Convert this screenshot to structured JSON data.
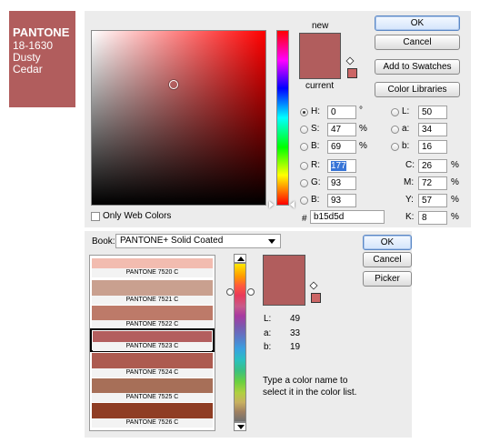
{
  "card": {
    "brand": "PANTONE",
    "code": "18-1630",
    "name_line1": "Dusty",
    "name_line2": "Cedar",
    "color": "#b15d5d"
  },
  "picker": {
    "new_label": "new",
    "current_label": "current",
    "ok": "OK",
    "cancel": "Cancel",
    "add_to_swatches": "Add to Swatches",
    "color_libraries": "Color Libraries",
    "only_web_colors": "Only Web Colors",
    "hsb": [
      {
        "label": "H:",
        "value": "0",
        "unit": "°"
      },
      {
        "label": "S:",
        "value": "47",
        "unit": "%"
      },
      {
        "label": "B:",
        "value": "69",
        "unit": "%"
      }
    ],
    "rgb": [
      {
        "label": "R:",
        "value": "177"
      },
      {
        "label": "G:",
        "value": "93"
      },
      {
        "label": "B:",
        "value": "93"
      }
    ],
    "lab": [
      {
        "label": "L:",
        "value": "50"
      },
      {
        "label": "a:",
        "value": "34"
      },
      {
        "label": "b:",
        "value": "16"
      }
    ],
    "cmyk": [
      {
        "label": "C:",
        "value": "26",
        "unit": "%"
      },
      {
        "label": "M:",
        "value": "72",
        "unit": "%"
      },
      {
        "label": "Y:",
        "value": "57",
        "unit": "%"
      },
      {
        "label": "K:",
        "value": "8",
        "unit": "%"
      }
    ],
    "hex_label": "#",
    "hex_value": "b15d5d"
  },
  "library": {
    "book_label": "Book:",
    "book_value": "PANTONE+ Solid Coated",
    "ok": "OK",
    "cancel": "Cancel",
    "picker": "Picker",
    "swatches": [
      {
        "name": "PANTONE 7520 C",
        "color": "#f2bcb0"
      },
      {
        "name": "PANTONE 7521 C",
        "color": "#c9a08f"
      },
      {
        "name": "PANTONE 7522 C",
        "color": "#bd7a69"
      },
      {
        "name": "PANTONE 7523 C",
        "color": "#b35e5e"
      },
      {
        "name": "PANTONE 7524 C",
        "color": "#ad5b50"
      },
      {
        "name": "PANTONE 7525 C",
        "color": "#a76f58"
      },
      {
        "name": "PANTONE 7526 C",
        "color": "#8f3d24"
      }
    ],
    "selected_index": 3,
    "lab": [
      {
        "label": "L:",
        "value": "49"
      },
      {
        "label": "a:",
        "value": "33"
      },
      {
        "label": "b:",
        "value": "19"
      }
    ],
    "hint": "Type a color name to select it in the color list."
  }
}
